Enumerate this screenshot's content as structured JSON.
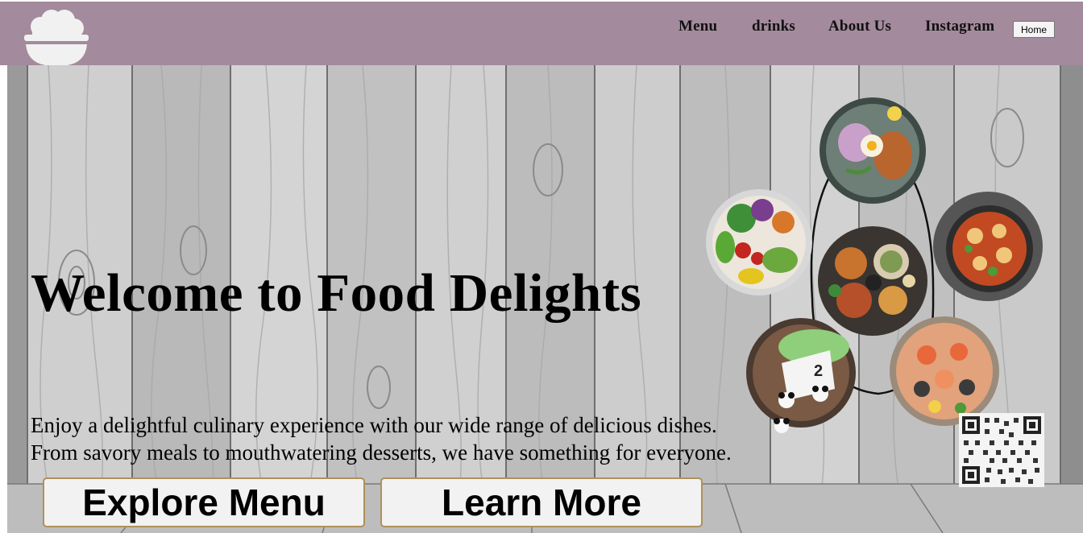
{
  "nav": {
    "logo_icon": "rice-bowl-icon",
    "links": [
      "Menu",
      "drinks",
      "About Us",
      "Instagram"
    ],
    "home_label": "Home"
  },
  "hero": {
    "title": "Welcome to Food Delights",
    "text_line1": "Enjoy a delightful culinary experience with our wide range of delicious dishes.",
    "text_line2": "From savory meals to mouthwatering desserts, we have something for everyone.",
    "explore_label": "Explore Menu",
    "learn_label": "Learn More"
  },
  "decor": {
    "food_images": [
      "salad-bowl",
      "fried-chicken-plate",
      "noodle-spread",
      "stew-pot",
      "panda-cake",
      "seafood-paella"
    ],
    "qr_code": "qr-code-icon"
  },
  "colors": {
    "navbar": "#a38a9c",
    "button_border": "#b0905a",
    "button_bg": "#f2f2f2",
    "wood": "#c9c9c9"
  }
}
